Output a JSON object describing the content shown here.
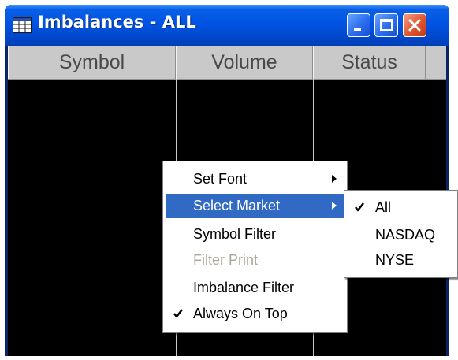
{
  "window": {
    "title": "Imbalances - ALL",
    "icon": "grid-icon",
    "buttons": [
      "minimize-icon",
      "maximize-icon",
      "close-icon"
    ]
  },
  "table": {
    "columns": [
      "Symbol",
      "Volume",
      "Status"
    ],
    "rows": []
  },
  "context_menu": {
    "items": [
      {
        "label": "Set Font",
        "submenu": true,
        "state": "normal"
      },
      {
        "label": "Select Market",
        "submenu": true,
        "state": "highlighted"
      },
      {
        "label": "Symbol Filter",
        "state": "normal"
      },
      {
        "label": "Filter Print",
        "state": "disabled"
      },
      {
        "label": "Imbalance Filter",
        "state": "normal"
      },
      {
        "label": "Always On Top",
        "state": "checked"
      }
    ]
  },
  "market_submenu": {
    "items": [
      {
        "label": "All",
        "checked": true
      },
      {
        "label": "NASDAQ",
        "checked": false
      },
      {
        "label": "NYSE",
        "checked": false
      }
    ]
  },
  "colors": {
    "title_bar": "#0054e3",
    "highlight": "#316ac5",
    "grid_background": "#000000",
    "header_background": "#c9c9c9",
    "disabled_text": "#aca899"
  }
}
